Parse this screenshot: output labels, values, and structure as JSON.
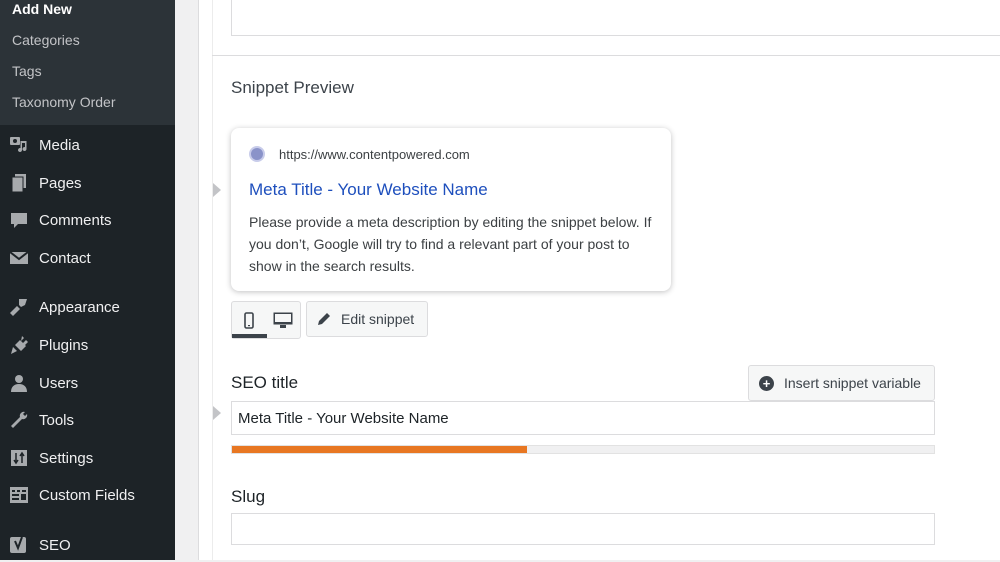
{
  "sidebar": {
    "submenu": [
      {
        "label": "Add New",
        "current": true
      },
      {
        "label": "Categories"
      },
      {
        "label": "Tags"
      },
      {
        "label": "Taxonomy Order"
      }
    ],
    "items": [
      {
        "label": "Media",
        "icon": "media-icon"
      },
      {
        "label": "Pages",
        "icon": "pages-icon"
      },
      {
        "label": "Comments",
        "icon": "comments-icon"
      },
      {
        "label": "Contact",
        "icon": "envelope-icon"
      },
      {
        "label": "Appearance",
        "icon": "paintbrush-icon"
      },
      {
        "label": "Plugins",
        "icon": "plugin-icon"
      },
      {
        "label": "Users",
        "icon": "user-icon"
      },
      {
        "label": "Tools",
        "icon": "wrench-icon"
      },
      {
        "label": "Settings",
        "icon": "settings-sliders-icon"
      },
      {
        "label": "Custom Fields",
        "icon": "custom-fields-icon"
      },
      {
        "label": "SEO",
        "icon": "yoast-icon"
      }
    ]
  },
  "snippet": {
    "section_title": "Snippet Preview",
    "url": "https://www.contentpowered.com",
    "meta_title": "Meta Title - Your Website Name",
    "meta_description": "Please provide a meta description by editing the snippet below. If you don’t, Google will try to find a relevant part of your post to show in the search results.",
    "mobile_label": "Mobile preview",
    "desktop_label": "Desktop preview",
    "edit_button": "Edit snippet"
  },
  "seo_title": {
    "label": "SEO title",
    "insert_button": "Insert snippet variable",
    "value": "Meta Title - Your Website Name",
    "progress_percent": 42,
    "progress_color": "#e87722"
  },
  "slug": {
    "label": "Slug",
    "value": ""
  },
  "colors": {
    "link": "#1e4fbd",
    "sidebar_bg": "#1d2327",
    "submenu_bg": "#2c3338"
  }
}
